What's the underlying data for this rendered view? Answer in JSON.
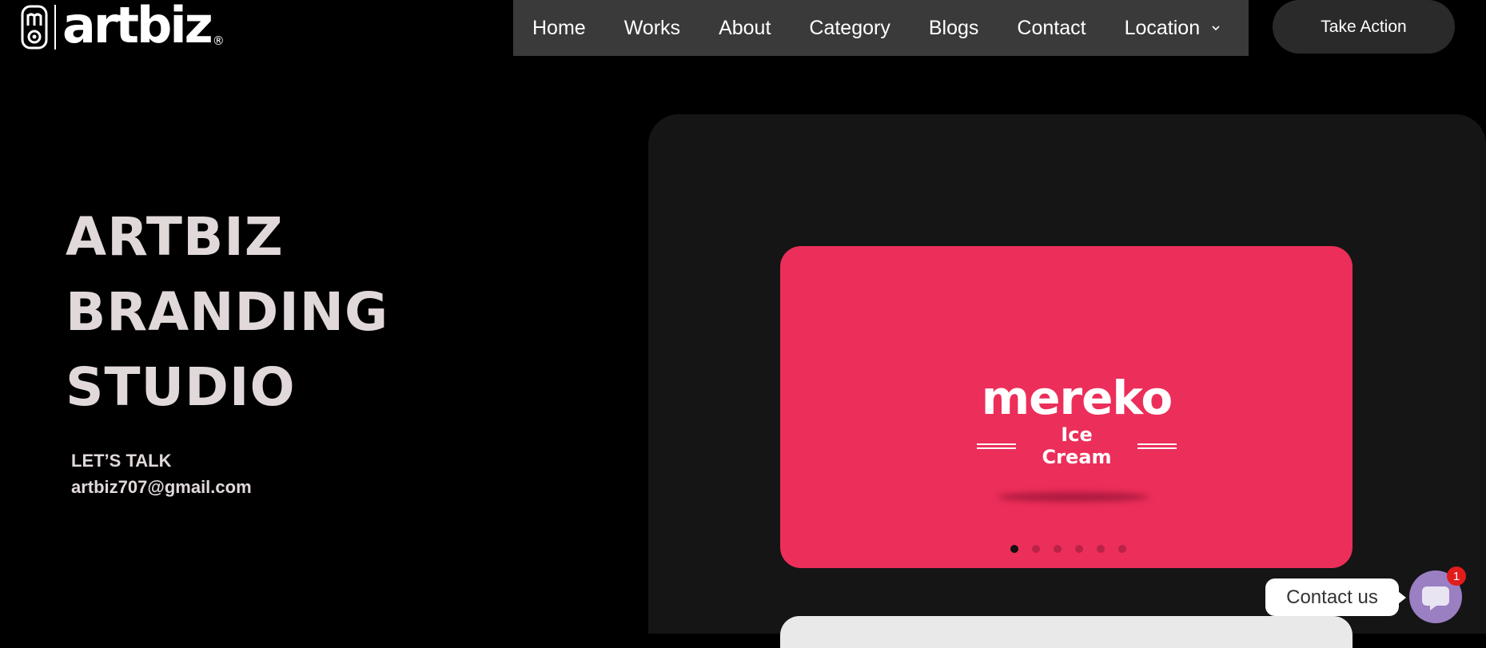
{
  "header": {
    "logo": {
      "wordmark": "artbiz",
      "registered": "®"
    },
    "nav": [
      {
        "label": "Home"
      },
      {
        "label": "Works"
      },
      {
        "label": "About"
      },
      {
        "label": "Category"
      },
      {
        "label": "Blogs"
      },
      {
        "label": "Contact"
      },
      {
        "label": "Location",
        "has_dropdown": true,
        "icon": "chevron-down-icon"
      }
    ],
    "cta_label": "Take Action"
  },
  "hero": {
    "title_lines": [
      "ARTBIZ",
      "BRANDING",
      "STUDIO"
    ],
    "contact_label": "LET’S TALK",
    "contact_email": "artbiz707@gmail.com"
  },
  "showcase": {
    "slide": {
      "brand_name": "mereko",
      "brand_tagline": "Ice Cream",
      "background_color": "#ec2e5a"
    },
    "slide_count": 6,
    "active_slide": 1
  },
  "chat_widget": {
    "bubble_label": "Contact us",
    "badge_count": "1",
    "icon": "chat-icon"
  },
  "colors": {
    "page_background": "#000000",
    "nav_background": "#3a3a3a",
    "panel_background": "#151515",
    "hero_text": "#e1d9d9",
    "chat_button": "#9a7fc3",
    "badge": "#e21b1b"
  }
}
